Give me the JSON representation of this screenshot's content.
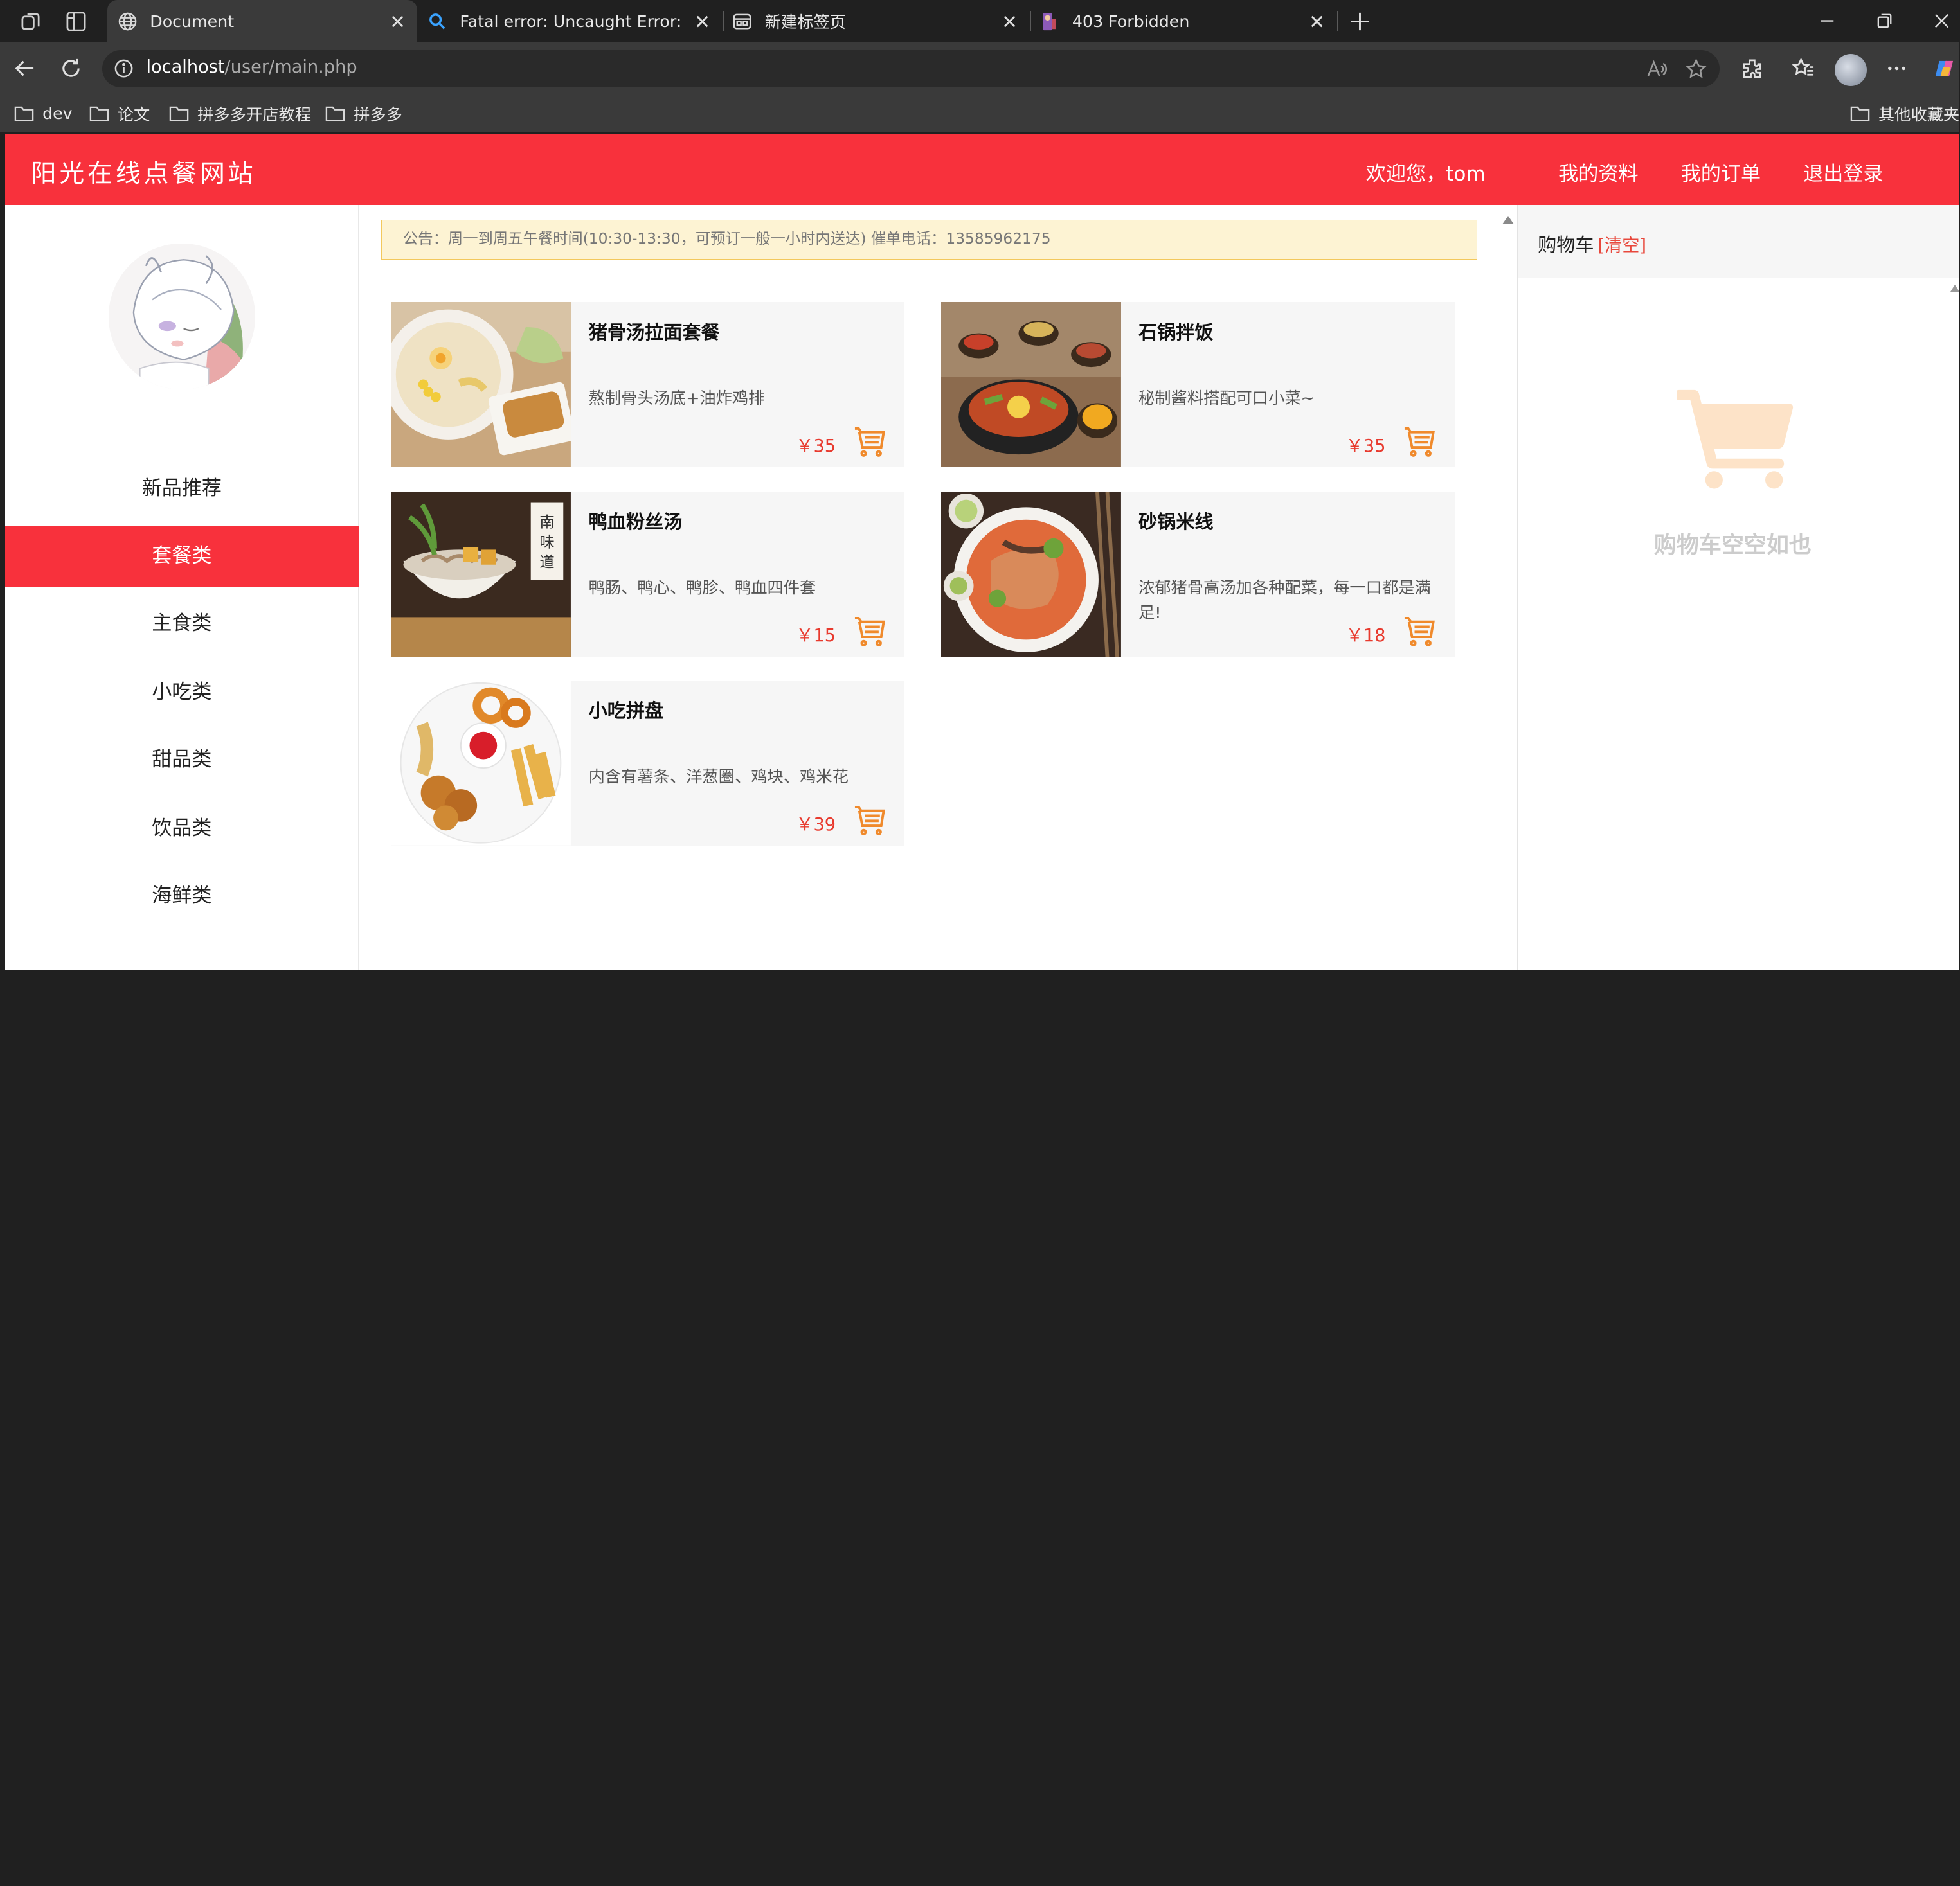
{
  "browser": {
    "tabs": [
      {
        "title": "Document",
        "icon": "globe-icon",
        "active": true
      },
      {
        "title": "Fatal error: Uncaught Error: Call to",
        "icon": "search-icon",
        "active": false
      },
      {
        "title": "新建标签页",
        "icon": "newtab-icon",
        "active": false
      },
      {
        "title": "403 Forbidden",
        "icon": "site-favicon-icon",
        "active": false
      }
    ],
    "url_host": "localhost",
    "url_path": "/user/main.php",
    "bookmarks": [
      "dev",
      "论文",
      "拼多多开店教程",
      "拼多多"
    ],
    "other_bookmarks": "其他收藏夹"
  },
  "header": {
    "brand": "阳光在线点餐网站",
    "welcome": "欢迎您，tom",
    "links": [
      "我的资料",
      "我的订单",
      "退出登录"
    ]
  },
  "sidebar": {
    "menu": [
      {
        "label": "新品推荐",
        "active": false
      },
      {
        "label": "套餐类",
        "active": true
      },
      {
        "label": "主食类",
        "active": false
      },
      {
        "label": "小吃类",
        "active": false
      },
      {
        "label": "甜品类",
        "active": false
      },
      {
        "label": "饮品类",
        "active": false
      },
      {
        "label": "海鲜类",
        "active": false
      }
    ]
  },
  "notice": "公告：周一到周五午餐时间(10:30-13:30，可预订一般一小时内送达) 催单电话：13585962175",
  "products": [
    {
      "name": "猪骨汤拉面套餐",
      "desc": "熬制骨头汤底+油炸鸡排",
      "price": "￥35"
    },
    {
      "name": "石锅拌饭",
      "desc": "秘制酱料搭配可口小菜~",
      "price": "￥35"
    },
    {
      "name": "鸭血粉丝汤",
      "desc": "鸭肠、鸭心、鸭胗、鸭血四件套",
      "price": "￥15"
    },
    {
      "name": "砂锅米线",
      "desc": "浓郁猪骨高汤加各种配菜，每一口都是满足!",
      "price": "￥18"
    },
    {
      "name": "小吃拼盘",
      "desc": "内含有薯条、洋葱圈、鸡块、鸡米花",
      "price": "￥39"
    }
  ],
  "cart": {
    "title": "购物车",
    "clear_label": "[清空]",
    "empty_text": "购物车空空如也"
  },
  "colors": {
    "brand_red": "#f8313c",
    "price_red": "#e83a2e",
    "cart_orange": "#f08a2c"
  }
}
